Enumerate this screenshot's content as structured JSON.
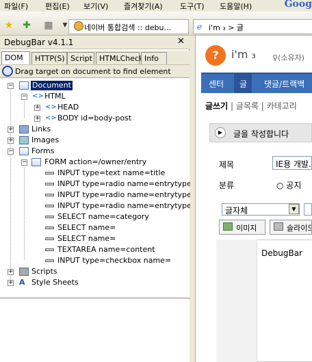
{
  "menubar": {
    "items": [
      "파일(F)",
      "편집(E)",
      "보기(V)",
      "즐겨찾기(A)",
      "도구(T)",
      "도움말(H)"
    ],
    "google": "Goog"
  },
  "toolbar": {
    "page_tab": "네이버 통합검색 :: debu...",
    "tab2": "i'm ₃ > 글"
  },
  "debugbar": {
    "title": "DebugBar v4.1.1",
    "close": "✕",
    "tabs": [
      "DOM",
      "HTTP(S)",
      "Script",
      "HTMLCheck",
      "Info"
    ],
    "drag_text": "Drag target on document to find element",
    "tree": {
      "document": "Document",
      "html": "HTML",
      "head": "HEAD",
      "body": "BODY id=body-post",
      "links": "Links",
      "images": "Images",
      "forms": "Forms",
      "form": "FORM action=/owner/entry",
      "fields": [
        "INPUT type=text name=title",
        "INPUT type=radio name=entrytype",
        "INPUT type=radio name=entrytype",
        "INPUT type=radio name=entrytype",
        "SELECT name=category",
        "SELECT name=",
        "SELECT name=",
        "TEXTAREA name=content",
        "INPUT type=checkbox name="
      ],
      "scripts": "Scripts",
      "stylesheets": "Style Sheets"
    }
  },
  "page": {
    "logo_glyph": "?",
    "logo_text": "i'm ₃",
    "user": "♀(소유자)",
    "nav": [
      "센터",
      "글",
      "댓글/트랙백"
    ],
    "subnav_active": "글쓰기",
    "subnav_rest": " | 글목록 | 카테고리",
    "write_header": "글을 작성합니다",
    "title_label": "제목",
    "title_value": "IE용 개발...",
    "category_label": "분류",
    "radio_public": "○ 공지",
    "font_select": "글자체",
    "btn_image": "이미지",
    "btn_slide": "슬라이드",
    "editor_text": "DebugBar"
  }
}
